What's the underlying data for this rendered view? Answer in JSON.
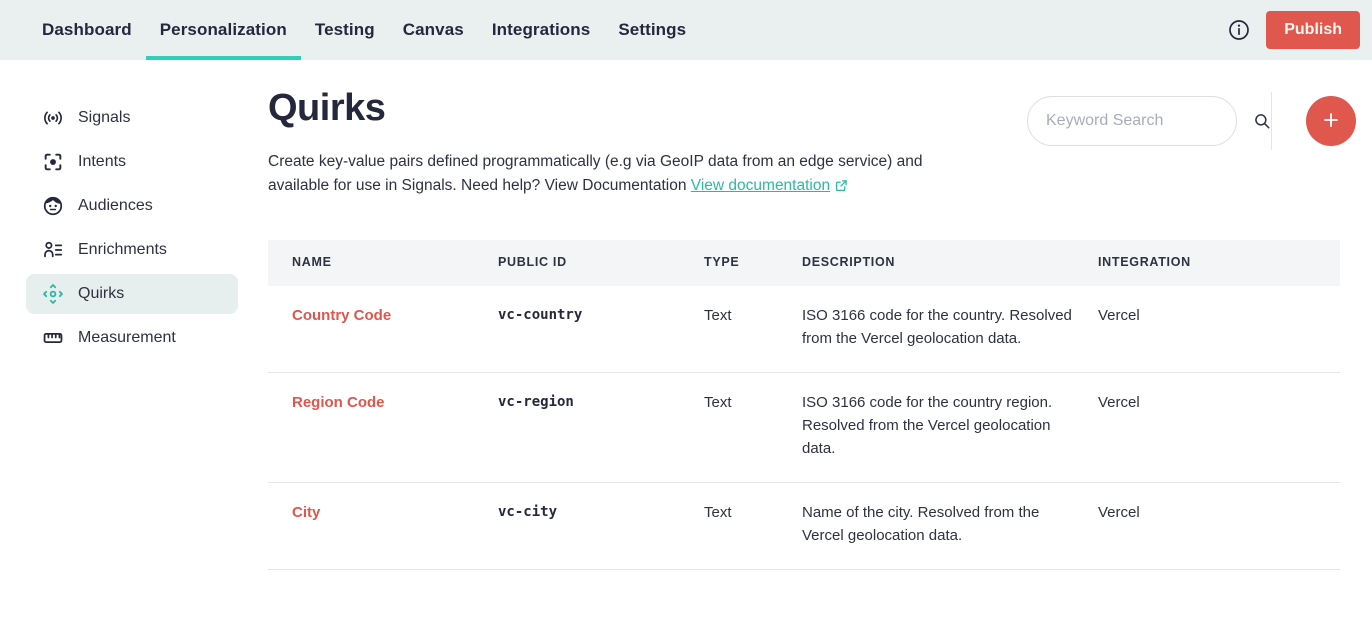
{
  "topnav": {
    "tabs": [
      {
        "label": "Dashboard",
        "active": false
      },
      {
        "label": "Personalization",
        "active": true
      },
      {
        "label": "Testing",
        "active": false
      },
      {
        "label": "Canvas",
        "active": false
      },
      {
        "label": "Integrations",
        "active": false
      },
      {
        "label": "Settings",
        "active": false
      }
    ],
    "info_icon": "info-circle-icon",
    "publish_label": "Publish",
    "active_indicator_color": "#33cdb8",
    "background_color": "#eaf0f0"
  },
  "sidebar": {
    "items": [
      {
        "label": "Signals",
        "icon": "broadcast-icon",
        "active": false
      },
      {
        "label": "Intents",
        "icon": "target-frame-icon",
        "active": false
      },
      {
        "label": "Audiences",
        "icon": "face-circle-icon",
        "active": false
      },
      {
        "label": "Enrichments",
        "icon": "person-list-icon",
        "active": false
      },
      {
        "label": "Quirks",
        "icon": "move-arrows-icon",
        "active": true
      },
      {
        "label": "Measurement",
        "icon": "ruler-icon",
        "active": false
      }
    ],
    "active_background": "#e7efee",
    "active_icon_color": "#2bb9a6"
  },
  "main": {
    "title": "Quirks",
    "description_line1": "Create key-value pairs defined programmatically (e.g via GeoIP data from an edge service) and",
    "description_line2": "available for use in Signals. Need help? View Documentation",
    "doc_link_label": "View documentation",
    "doc_link_icon": "external-link-icon",
    "doc_link_color": "#2bb9a6"
  },
  "search": {
    "placeholder": "Keyword Search",
    "value": "",
    "icon": "search-icon"
  },
  "add_button": {
    "icon": "plus-icon",
    "color": "#e0574d"
  },
  "table": {
    "columns": [
      "NAME",
      "PUBLIC ID",
      "TYPE",
      "DESCRIPTION",
      "INTEGRATION"
    ],
    "rows": [
      {
        "name": "Country Code",
        "public_id": "vc-country",
        "type": "Text",
        "description": "ISO 3166 code for the country. Resolved from the Vercel geolocation data.",
        "integration": "Vercel"
      },
      {
        "name": "Region Code",
        "public_id": "vc-region",
        "type": "Text",
        "description": "ISO 3166 code for the country region. Resolved from the Vercel geolocation data.",
        "integration": "Vercel"
      },
      {
        "name": "City",
        "public_id": "vc-city",
        "type": "Text",
        "description": "Name of the city. Resolved from the Vercel geolocation data.",
        "integration": "Vercel"
      }
    ],
    "header_background": "#f4f5f7",
    "name_link_color": "#df564c"
  }
}
